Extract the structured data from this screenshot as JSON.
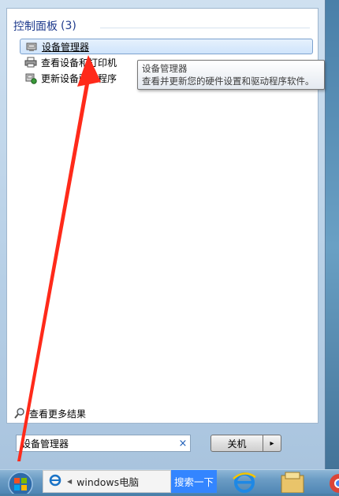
{
  "start_menu": {
    "group": {
      "title": "控制面板",
      "count": "(3)"
    },
    "results": [
      {
        "label": "设备管理器",
        "icon": "device-manager-icon",
        "selected": true
      },
      {
        "label": "查看设备和打印机",
        "icon": "printer-icon",
        "selected": false
      },
      {
        "label": "更新设备驱动程序",
        "icon": "driver-update-icon",
        "selected": false
      }
    ],
    "tooltip": {
      "title": "设备管理器",
      "description": "查看并更新您的硬件设置和驱动程序软件。"
    },
    "see_more": "查看更多结果",
    "search": {
      "value": "设备管理器",
      "clear": "×"
    },
    "shutdown": {
      "label": "关机",
      "arrow": "▸"
    }
  },
  "taskbar": {
    "browser_text": "windows电脑",
    "search_button": "搜索一下"
  },
  "colors": {
    "header_blue": "#1e3a8c",
    "annotation_red": "#ff2a1a",
    "baidu_blue": "#3385ff"
  }
}
